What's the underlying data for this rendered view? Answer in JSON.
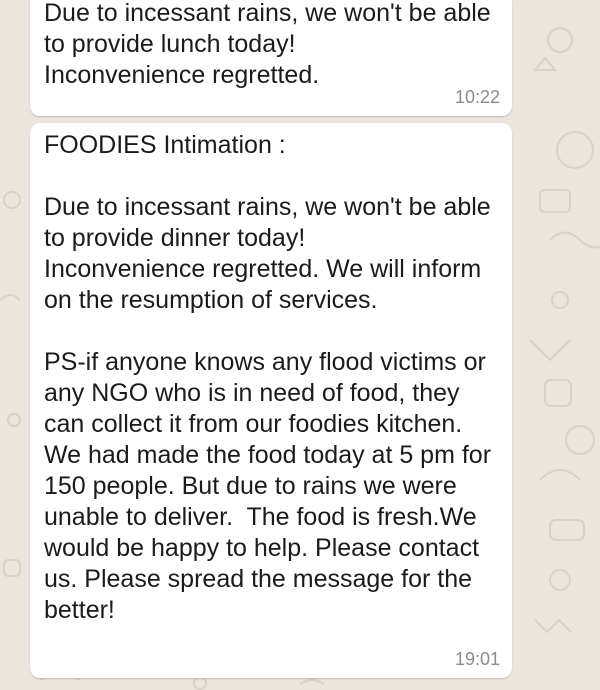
{
  "messages": [
    {
      "text": "Due to incessant rains, we won't be able to provide lunch today!\nInconvenience regretted.",
      "time": "10:22"
    },
    {
      "text": "FOODIES Intimation :\n\nDue to incessant rains, we won't be able to provide dinner today!\nInconvenience regretted. We will inform on the resumption of services.\n\nPS-if anyone knows any flood victims or any NGO who is in need of food, they can collect it from our foodies kitchen. We had made the food today at 5 pm for 150 people. But due to rains we were unable to deliver.  The food is fresh.We would be happy to help. Please contact us. Please spread the message for the better!",
      "time": "19:01"
    }
  ],
  "colors": {
    "background": "#ece5dd",
    "bubble": "#ffffff",
    "timestamp": "#8c8c8c",
    "text": "#1b1b1b"
  }
}
